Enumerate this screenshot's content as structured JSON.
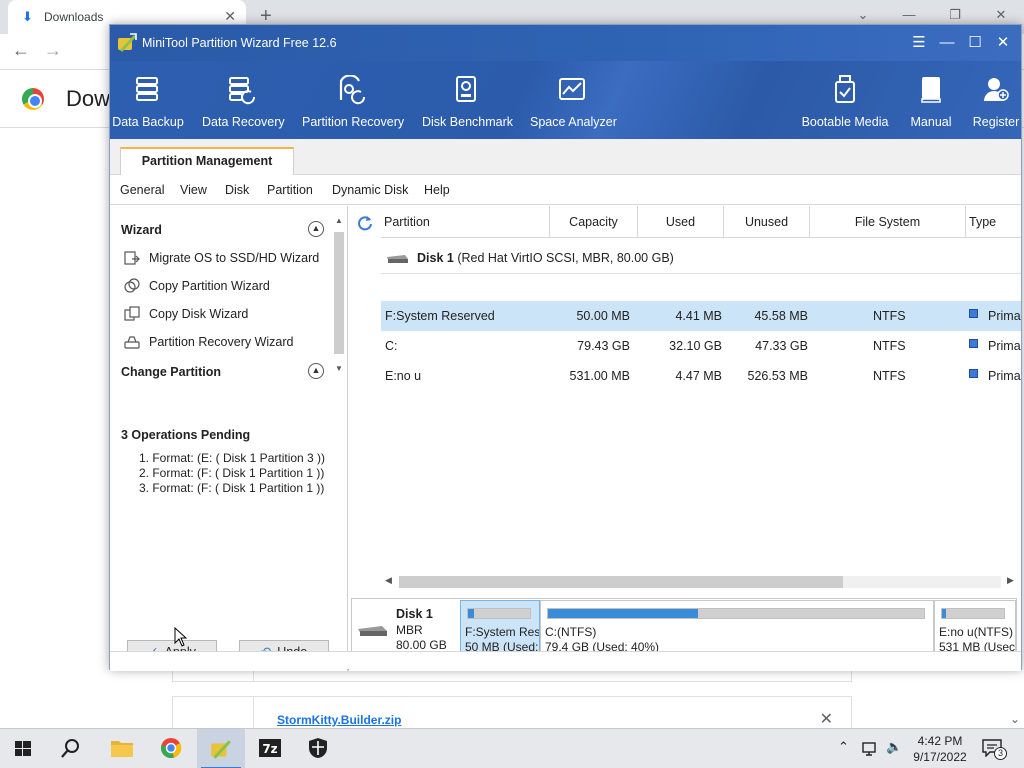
{
  "browser": {
    "tab_title": "Downloads",
    "page_title": "Dow",
    "downloads": [
      {
        "name": "StormKitty.Builder.zip"
      }
    ]
  },
  "window": {
    "title": "MiniTool Partition Wizard Free 12.6",
    "controls": [
      "menu-icon",
      "minimize-icon",
      "maximize-icon",
      "close-icon"
    ]
  },
  "toolbar": {
    "left": [
      {
        "label": "Data Backup",
        "icon": "data-backup-icon"
      },
      {
        "label": "Data Recovery",
        "icon": "data-recovery-icon"
      },
      {
        "label": "Partition Recovery",
        "icon": "partition-recovery-icon"
      },
      {
        "label": "Disk Benchmark",
        "icon": "disk-benchmark-icon"
      },
      {
        "label": "Space Analyzer",
        "icon": "space-analyzer-icon"
      }
    ],
    "right": [
      {
        "label": "Bootable Media",
        "icon": "bootable-media-icon"
      },
      {
        "label": "Manual",
        "icon": "manual-icon"
      },
      {
        "label": "Register",
        "icon": "register-icon"
      }
    ]
  },
  "tabs": {
    "active": "Partition Management"
  },
  "menu": [
    "General",
    "View",
    "Disk",
    "Partition",
    "Dynamic Disk",
    "Help"
  ],
  "sidebar": {
    "wizard_title": "Wizard",
    "wizard_items": [
      {
        "label": "Migrate OS to SSD/HD Wizard"
      },
      {
        "label": "Copy Partition Wizard"
      },
      {
        "label": "Copy Disk Wizard"
      },
      {
        "label": "Partition Recovery Wizard"
      }
    ],
    "change_title": "Change Partition",
    "ops_title": "3 Operations Pending",
    "ops": [
      "1. Format: (E: ( Disk 1 Partition 3 ))",
      "2. Format: (F: ( Disk 1 Partition 1 ))",
      "3. Format: (F: ( Disk 1 Partition 1 ))"
    ],
    "apply_label": "Apply",
    "undo_label": "Undo"
  },
  "table": {
    "headers": [
      "Partition",
      "Capacity",
      "Used",
      "Unused",
      "File System",
      "Type"
    ],
    "disk": {
      "name": "Disk 1",
      "desc": "(Red Hat VirtIO SCSI, MBR, 80.00 GB)"
    },
    "rows": [
      {
        "partition": "F:System Reserved",
        "capacity": "50.00 MB",
        "used": "4.41 MB",
        "unused": "45.58 MB",
        "fs": "NTFS",
        "type": "Prima"
      },
      {
        "partition": "C:",
        "capacity": "79.43 GB",
        "used": "32.10 GB",
        "unused": "47.33 GB",
        "fs": "NTFS",
        "type": "Prima"
      },
      {
        "partition": "E:no u",
        "capacity": "531.00 MB",
        "used": "4.47 MB",
        "unused": "526.53 MB",
        "fs": "NTFS",
        "type": "Prima"
      }
    ]
  },
  "diskmap": {
    "name": "Disk 1",
    "style": "MBR",
    "size": "80.00 GB",
    "parts": [
      {
        "l1": "F:System Res",
        "l2": "50 MB (Used:",
        "used_fraction": 0.09
      },
      {
        "l1": "C:(NTFS)",
        "l2": "79.4 GB (Used: 40%)",
        "used_fraction": 0.4
      },
      {
        "l1": "E:no u(NTFS)",
        "l2": "531 MB (Usec",
        "used_fraction": 0.01
      }
    ]
  },
  "taskbar": {
    "time": "4:42 PM",
    "date": "9/17/2022",
    "notifications": "3"
  },
  "colors": {
    "accent": "#2f64b4",
    "selection": "#cce4f7",
    "used_bar": "#3a8bd8"
  }
}
